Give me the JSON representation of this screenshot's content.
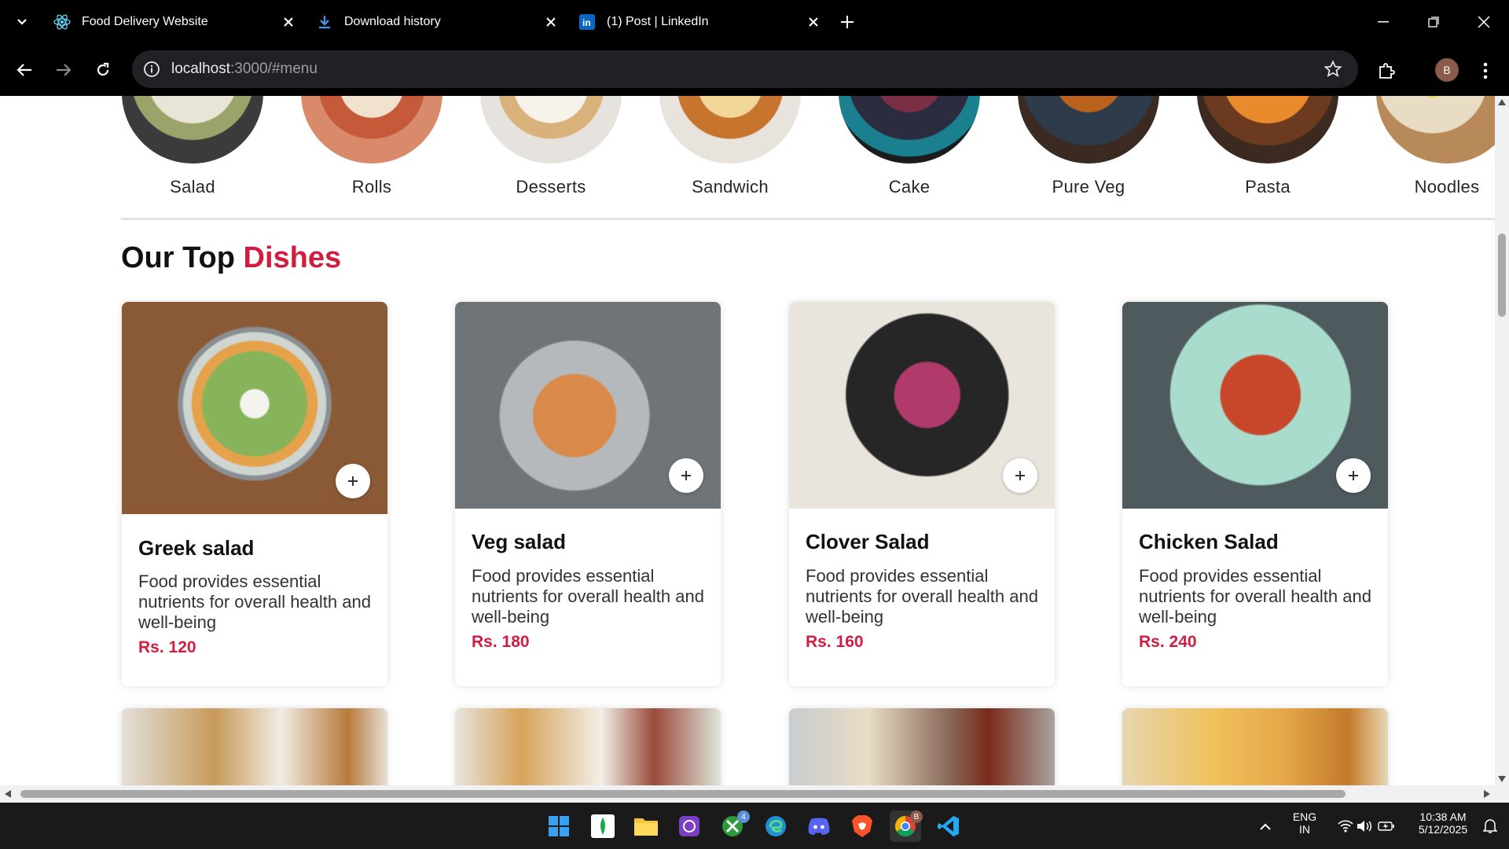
{
  "browser": {
    "tabs": [
      {
        "title": "Food Delivery Website",
        "icon": "react-icon"
      },
      {
        "title": "Download history",
        "icon": "download-icon"
      },
      {
        "title": "(1) Post | LinkedIn",
        "icon": "linkedin-icon"
      }
    ],
    "url_host": "localhost",
    "url_rest": ":3000/#menu",
    "profile_initial": "B"
  },
  "categories": [
    {
      "label": "Salad"
    },
    {
      "label": "Rolls"
    },
    {
      "label": "Desserts"
    },
    {
      "label": "Sandwich"
    },
    {
      "label": "Cake"
    },
    {
      "label": "Pure Veg"
    },
    {
      "label": "Pasta"
    },
    {
      "label": "Noodles"
    }
  ],
  "section": {
    "title_main": "Our Top",
    "title_accent": "Dishes"
  },
  "dishes": [
    {
      "name": "Greek salad",
      "description": "Food provides essential nutrients for overall health and well-being",
      "price": "Rs. 120"
    },
    {
      "name": "Veg salad",
      "description": "Food provides essential nutrients for overall health and well-being",
      "price": "Rs. 180"
    },
    {
      "name": "Clover Salad",
      "description": "Food provides essential nutrients for overall health and well-being",
      "price": "Rs. 160"
    },
    {
      "name": "Chicken Salad",
      "description": "Food provides essential nutrients for overall health and well-being",
      "price": "Rs. 240"
    }
  ],
  "taskbar": {
    "language": "ENG",
    "region": "IN",
    "time": "10:38 AM",
    "date": "5/12/2025",
    "xbox_badge": "4",
    "chrome_badge": "B"
  },
  "colors": {
    "accent": "#d11d3f",
    "chrome_bg": "#000000",
    "omnibox_bg": "#202124"
  }
}
